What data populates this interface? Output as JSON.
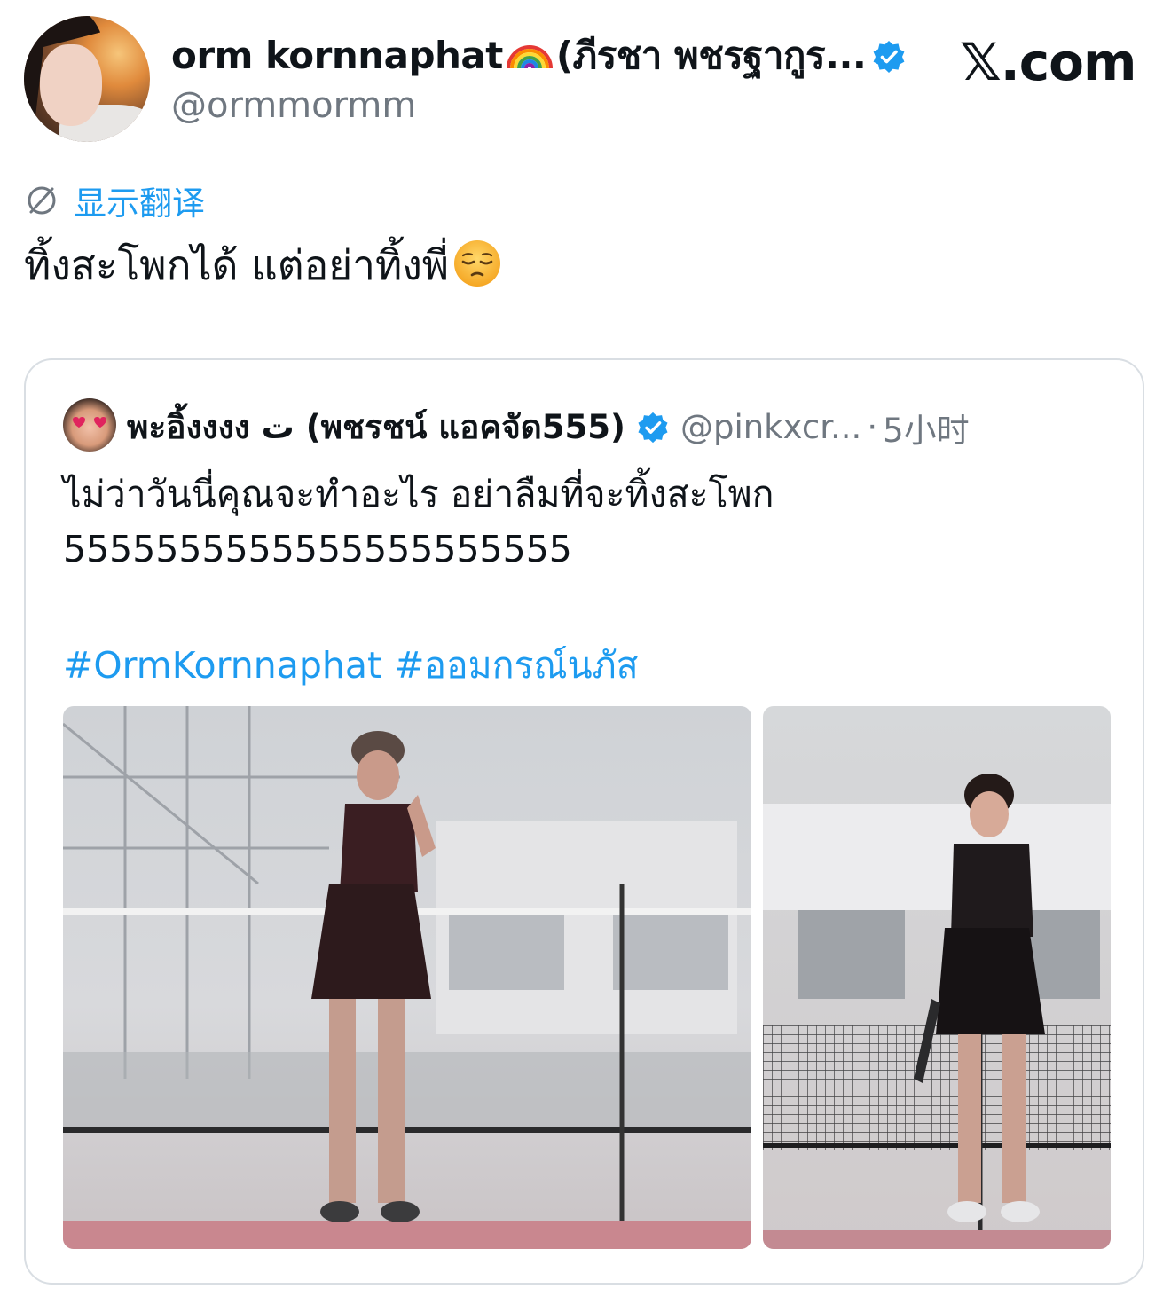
{
  "header": {
    "display_name": "orm kornnaphat",
    "display_name_suffix": "(ภีรชา พชรฐากูร...",
    "rainbow_icon": "rainbow-emoji",
    "verified_icon": "verified-badge-icon",
    "handle": "@ormmormm",
    "brand": "𝕏.com"
  },
  "translate": {
    "icon": "globe-icon",
    "label": "显示翻译"
  },
  "tweet": {
    "text": "ทิ้งสะโพกได้ แต่อย่าทิ้งพี่",
    "emoji": "pensive-face-emoji"
  },
  "quote": {
    "display_name": "พะอิ้งงงง ت (พชรชน์ แอคจัด555)",
    "handle": "@pinkxcr...",
    "separator": "·",
    "time": "5小时",
    "text_line_1": "ไม่ว่าวันนี่คุณจะทำอะไร อย่าลืมที่จะทิ้งสะโพก",
    "text_line_2": "5555555555555555555555",
    "hashtags": [
      "#OrmKornnaphat",
      "#ออมกรณ์นภัส"
    ]
  },
  "colors": {
    "link": "#1d9bf0",
    "muted": "#6f7780",
    "text": "#0f1419",
    "border": "#d9dee3"
  }
}
